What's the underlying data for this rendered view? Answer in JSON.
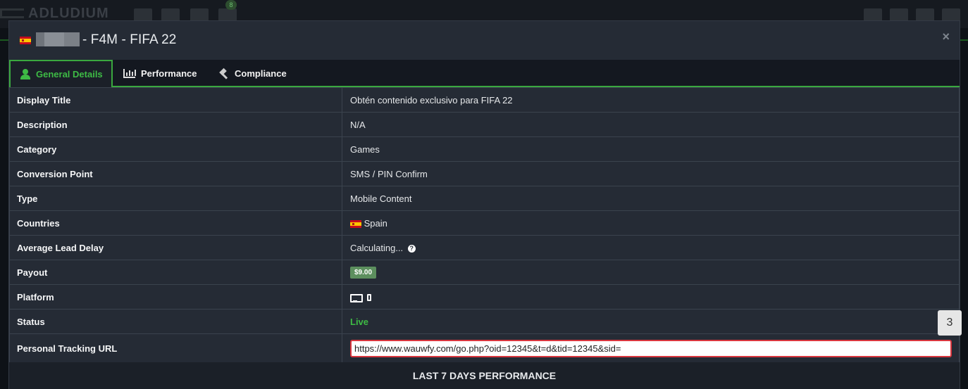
{
  "app": {
    "logo_text": "ADLUDIUM",
    "notification_count": "8"
  },
  "modal": {
    "title": "- F4M - FIFA 22",
    "close_glyph": "×"
  },
  "tabs": [
    {
      "label": "General Details",
      "active": true
    },
    {
      "label": "Performance",
      "active": false
    },
    {
      "label": "Compliance",
      "active": false
    }
  ],
  "details": {
    "display_title": {
      "label": "Display Title",
      "value": "Obtén contenido exclusivo para FIFA 22"
    },
    "description": {
      "label": "Description",
      "value": "N/A"
    },
    "category": {
      "label": "Category",
      "value": "Games"
    },
    "conversion_point": {
      "label": "Conversion Point",
      "value": "SMS / PIN Confirm"
    },
    "type": {
      "label": "Type",
      "value": "Mobile Content"
    },
    "countries": {
      "label": "Countries",
      "value": "Spain"
    },
    "average_lead_delay": {
      "label": "Average Lead Delay",
      "value": "Calculating...",
      "help_glyph": "?"
    },
    "payout": {
      "label": "Payout",
      "value": "$9.00"
    },
    "platform": {
      "label": "Platform",
      "icons": [
        "desktop-icon",
        "mobile-icon"
      ]
    },
    "status": {
      "label": "Status",
      "value": "Live"
    },
    "tracking_url": {
      "label": "Personal Tracking URL",
      "value": "https://www.wauwfy.com/go.php?oid=12345&t=d&tid=12345&sid="
    }
  },
  "section_heading": "LAST 7 DAYS PERFORMANCE",
  "counter_badge": "3",
  "colors": {
    "accent": "#3aa83f",
    "live": "#3ebb45",
    "panel": "#252b35",
    "error_border": "#d9363e"
  }
}
